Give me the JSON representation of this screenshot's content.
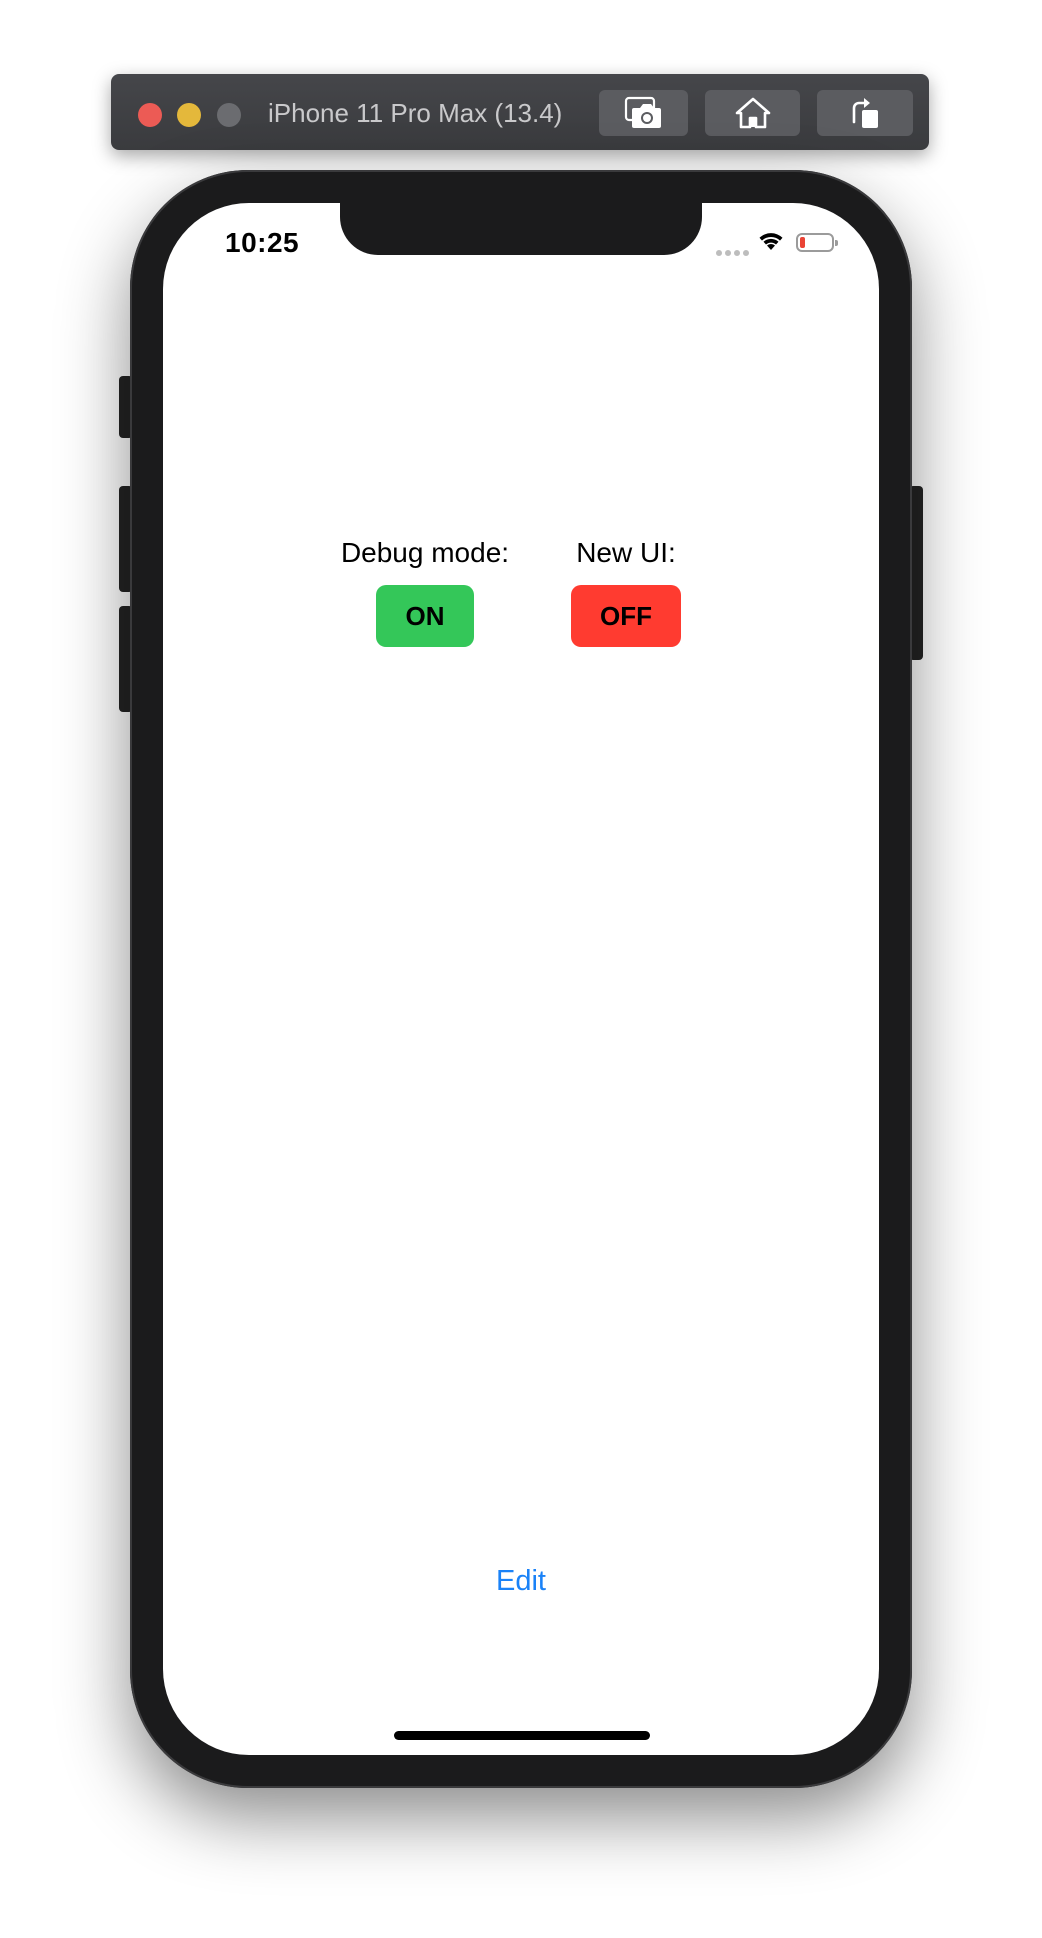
{
  "simulator": {
    "title": "iPhone 11 Pro Max (13.4)",
    "buttons": [
      {
        "name": "screenshot",
        "icon": "camera-icon"
      },
      {
        "name": "home",
        "icon": "home-icon"
      },
      {
        "name": "rotate",
        "icon": "rotate-icon"
      }
    ],
    "traffic_lights": {
      "close": "#ec5b55",
      "minimize": "#e4b83b",
      "zoom": "#6b6c70"
    }
  },
  "status_bar": {
    "time": "10:25",
    "battery_level": 0.15,
    "battery_color": "#ea4335"
  },
  "settings": {
    "debug": {
      "label": "Debug mode:",
      "value": "ON",
      "color": "#34c759"
    },
    "new_ui": {
      "label": "New UI:",
      "value": "OFF",
      "color": "#ff3b30"
    }
  },
  "footer": {
    "edit_label": "Edit",
    "link_color": "#1a82f7"
  }
}
